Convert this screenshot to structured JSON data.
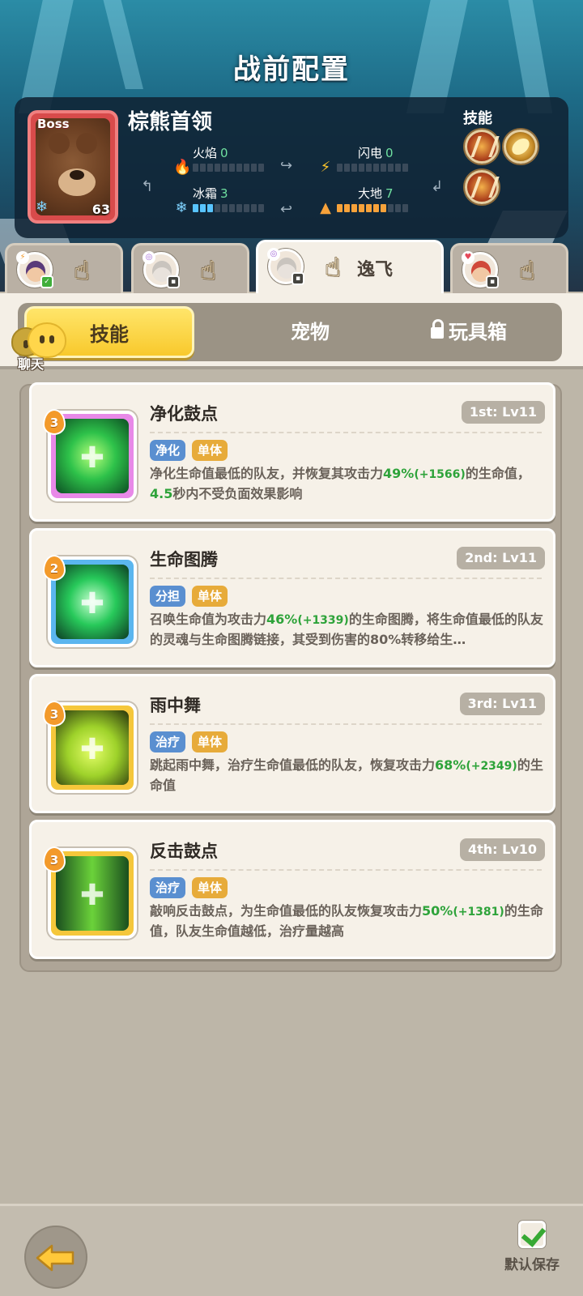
{
  "header": {
    "title": "战前配置"
  },
  "boss": {
    "tag": "Boss",
    "level": "63",
    "name": "棕熊首领",
    "stats": [
      {
        "label": "火焰",
        "value": "0",
        "filled": 0,
        "total": 10
      },
      {
        "label": "闪电",
        "value": "0",
        "filled": 0,
        "total": 10
      },
      {
        "label": "冰霜",
        "value": "3",
        "filled": 3,
        "total": 10
      },
      {
        "label": "大地",
        "value": "7",
        "filled": 7,
        "total": 10
      }
    ],
    "skills_title": "技能",
    "skill_icons": [
      "claw-skill-icon",
      "beast-skill-icon",
      "slash-skill-icon"
    ]
  },
  "hero_tabs": [
    {
      "name": "",
      "active": false
    },
    {
      "name": "",
      "active": false
    },
    {
      "name": "逸飞",
      "active": true
    },
    {
      "name": "",
      "active": false
    }
  ],
  "category_tabs": {
    "skills": "技能",
    "pets": "宠物",
    "toybox": "玩具箱",
    "active": "技能"
  },
  "chat": {
    "label": "聊天"
  },
  "skills": [
    {
      "rank": "3",
      "name": "净化鼓点",
      "level": "1st: Lv11",
      "tags": [
        "净化",
        "单体"
      ],
      "desc": [
        "净化生命值最低的队友，并恢复其攻击力",
        "49%",
        "(+1566)",
        "的生命值，",
        "4.5",
        "秒内不受负面效果影响"
      ]
    },
    {
      "rank": "2",
      "name": "生命图腾",
      "level": "2nd: Lv11",
      "tags": [
        "分担",
        "单体"
      ],
      "desc": [
        "召唤生命值为攻击力",
        "46%",
        "(+1339)",
        "的生命图腾，将生命值最低的队友的灵魂与生命图腾链接，其受到伤害的80%转移给生…",
        "",
        ""
      ]
    },
    {
      "rank": "3",
      "name": "雨中舞",
      "level": "3rd: Lv11",
      "tags": [
        "治疗",
        "单体"
      ],
      "desc": [
        "跳起雨中舞，治疗生命值最低的队友，恢复攻击力",
        "68%",
        "(+2349)",
        "的生命值",
        "",
        ""
      ]
    },
    {
      "rank": "3",
      "name": "反击鼓点",
      "level": "4th: Lv10",
      "tags": [
        "治疗",
        "单体"
      ],
      "desc": [
        "敲响反击鼓点，为生命值最低的队友恢复攻击力",
        "50%",
        "(+1381)",
        "的生命值，队友生命值越低，治疗量越高",
        "",
        ""
      ]
    }
  ],
  "footer": {
    "save_label": "默认保存"
  }
}
